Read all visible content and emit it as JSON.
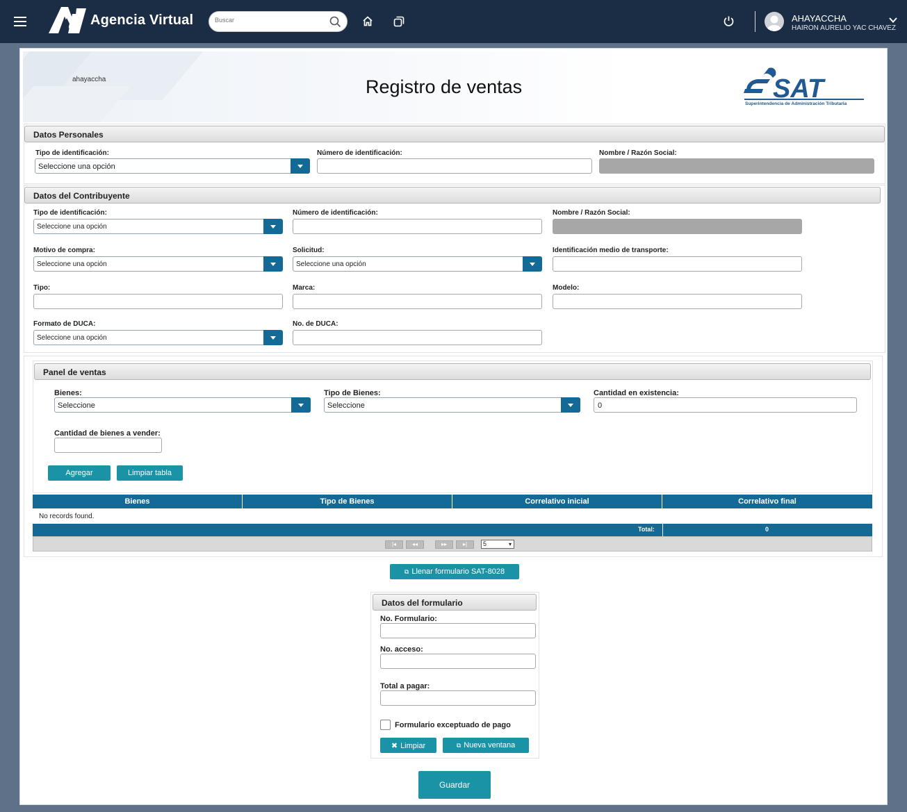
{
  "topbar": {
    "brand": "Agencia Virtual",
    "search_placeholder": "Buscar",
    "user_name": "AHAYACCHA",
    "user_full_name": "HAIRON AURELIO YAC CHAVEZ",
    "icons": [
      "menu-icon",
      "search-icon",
      "home-icon",
      "copy-icon",
      "power-icon",
      "chevron-down-icon"
    ]
  },
  "header": {
    "username": "ahayaccha",
    "title": "Registro de ventas",
    "logo_text": "SAT",
    "logo_subtitle": "Superintendencia de Administración Tributaria"
  },
  "datos_personales": {
    "heading": "Datos Personales",
    "tipo_label": "Tipo de identificación:",
    "tipo_value": "Seleccione una opción",
    "numero_label": "Número de identificación:",
    "nombre_label": "Nombre / Razón Social:"
  },
  "contribuyente": {
    "heading": "Datos del Contribuyente",
    "tipo_label": "Tipo de identificación:",
    "tipo_value": "Seleccione una opción",
    "numero_label": "Número de identificación:",
    "nombre_label": "Nombre / Razón Social:",
    "motivo_label": "Motivo de compra:",
    "motivo_value": "Seleccione una opción",
    "solicitud_label": "Solicitud:",
    "solicitud_value": "Seleccione una opción",
    "transporte_label": "Identificación medio de transporte:",
    "tipo2_label": "Tipo:",
    "marca_label": "Marca:",
    "modelo_label": "Modelo:",
    "formato_label": "Formato de DUCA:",
    "formato_value": "Seleccione una opción",
    "duca_label": "No. de DUCA:"
  },
  "panel_ventas": {
    "heading": "Panel de ventas",
    "bienes_label": "Bienes:",
    "bienes_value": "Seleccione",
    "tipo_bienes_label": "Tipo de Bienes:",
    "tipo_bienes_value": "Seleccione",
    "existencia_label": "Cantidad en existencia:",
    "existencia_value": "0",
    "vender_label": "Cantidad de bienes a vender:",
    "agregar": "Agregar",
    "limpiar_tabla": "Limpiar tabla"
  },
  "table": {
    "columns": [
      "Bienes",
      "Tipo de Bienes",
      "Correlativo inicial",
      "Correlativo final"
    ],
    "empty_message": "No records found.",
    "total_label": "Total:",
    "total_value": "0",
    "rows_per_page": "5"
  },
  "llenar_button": "Llenar formulario SAT-8028",
  "formulario": {
    "heading": "Datos del formulario",
    "no_formulario_label": "No. Formulario:",
    "no_acceso_label": "No. acceso:",
    "total_label": "Total a pagar:",
    "exceptuado_label": "Formulario exceptuado de pago",
    "exceptuado_checked": false,
    "limpiar": "Limpiar",
    "nueva_ventana": "Nueva ventana"
  },
  "guardar": "Guardar",
  "colors": {
    "topbar": "#1b2d45",
    "primary": "#146a96",
    "teal": "#1b93a6",
    "background": "#5f7089"
  }
}
